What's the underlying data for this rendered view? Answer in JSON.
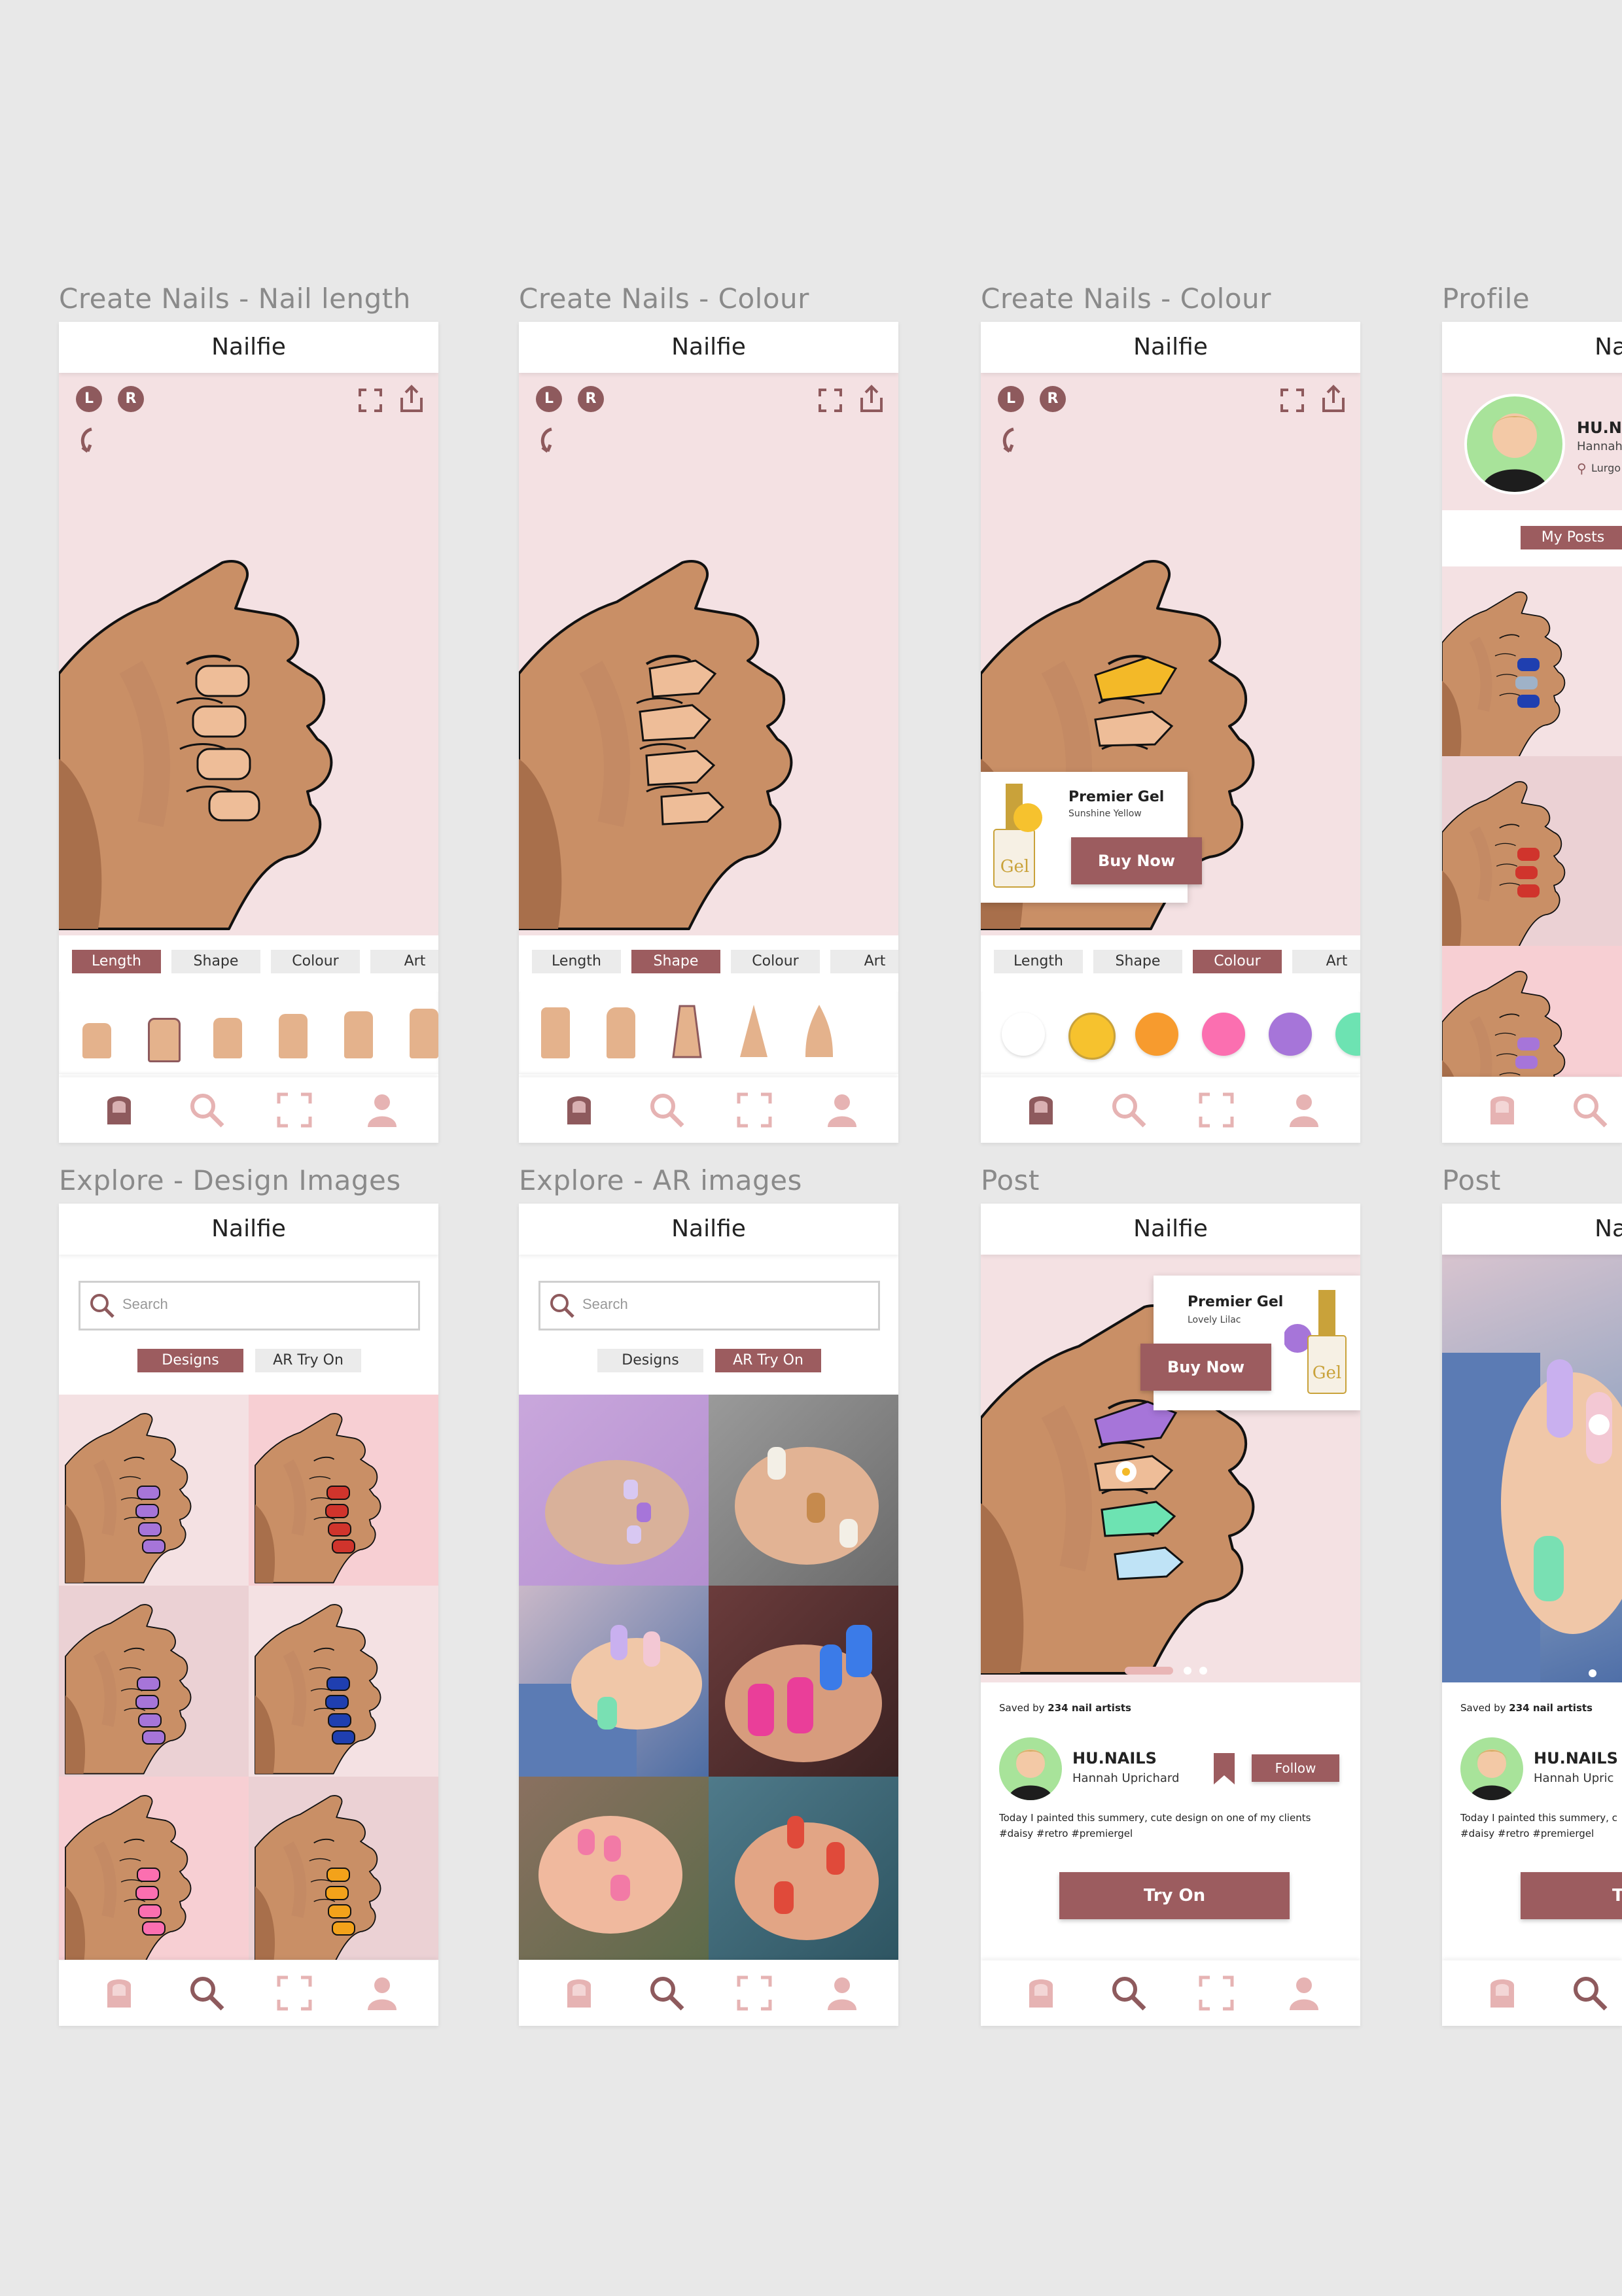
{
  "screens": {
    "length": {
      "label": "Create Nails - Nail length",
      "title": "Nailfie"
    },
    "shape": {
      "label": "Create Nails - Colour",
      "title": "Nailfie"
    },
    "colour": {
      "label": "Create Nails - Colour",
      "title": "Nailfie"
    },
    "profile": {
      "label": "Profile",
      "title": "Nailfie"
    },
    "explore_designs": {
      "label": "Explore - Design Images",
      "title": "Nailfie"
    },
    "explore_ar": {
      "label": "Explore - AR images",
      "title": "Nailfie"
    },
    "post": {
      "label": "Post",
      "title": "Nailfie"
    },
    "post2": {
      "label": "Post",
      "title": "Nailfie"
    }
  },
  "hand_controls": {
    "left": "L",
    "right": "R"
  },
  "tabs": {
    "length": "Length",
    "shape": "Shape",
    "colour": "Colour",
    "art": "Art"
  },
  "colour_swatches": [
    "#ffffff",
    "#f6c22e",
    "#f79b2e",
    "#fb6fb0",
    "#a675d9",
    "#6de3b2"
  ],
  "product_popup_colour": {
    "brand": "Premier Gel",
    "shade": "Sunshine Yellow",
    "buy": "Buy Now",
    "swatch": "#f6c22e"
  },
  "product_popup_post": {
    "brand": "Premier Gel",
    "shade": "Lovely Lilac",
    "buy": "Buy Now",
    "swatch": "#a675d9"
  },
  "profile": {
    "name": "HU.NAI",
    "subname": "Hannah",
    "location": "Lurgo",
    "my_posts": "My Posts"
  },
  "search": {
    "placeholder": "Search"
  },
  "explore_tabs": {
    "designs": "Designs",
    "ar": "AR Try On"
  },
  "post": {
    "saved_prefix": "Saved by ",
    "saved_count": "234 nail artists",
    "user": "HU.NAILS",
    "user_name": "Hannah Uprichard",
    "follow": "Follow",
    "caption_line1": "Today I painted this summery, cute design on one of my clients",
    "caption_line2": "#daisy #retro #premiergel",
    "try_on": "Try On"
  },
  "post2": {
    "saved_prefix": "Saved by ",
    "saved_count": "234 nail artists",
    "user": "HU.NAILS",
    "user_name": "Hannah Upric",
    "caption_line1": "Today I painted this summery, c",
    "caption_line2": "#daisy #retro #premiergel",
    "try_on": "Tr"
  },
  "design_nail_colours": [
    "#a675d9",
    "#d0342c",
    "#a675d9",
    "#1f3fb0",
    "#fb6fb0",
    "#f3a21a"
  ],
  "colors": {
    "accent": "#9c5c5f",
    "pink_bg": "#f4e1e3",
    "skin": "#c98f66"
  }
}
